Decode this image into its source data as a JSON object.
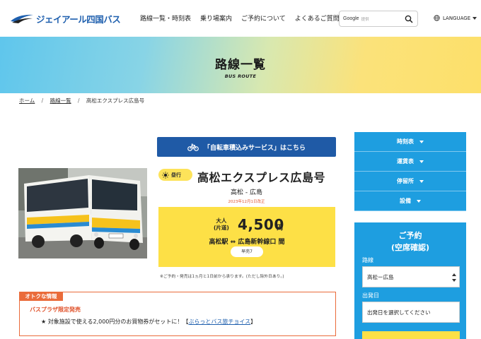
{
  "header": {
    "logo_text": "ジェイアール四国バス",
    "nav": [
      "路線一覧・時刻表",
      "乗り場案内",
      "ご予約について",
      "よくあるご質問"
    ],
    "search_brand": "Google",
    "search_hint": "提供",
    "language_label": "LANGUAGE"
  },
  "hero": {
    "title": "路線一覧",
    "subtitle": "BUS ROUTE"
  },
  "breadcrumb": {
    "home": "ホーム",
    "list": "路線一覧",
    "current": "高松エクスプレス広島号"
  },
  "bike_button_label": "「自転車積込みサービス」はこちら",
  "route": {
    "badge": "昼行",
    "title": "高松エクスプレス広島号",
    "subtitle": "高松 - 広島",
    "revised": "2023年12月1日改正"
  },
  "fare": {
    "type_line1": "大人",
    "type_line2": "(片道)",
    "price": "4,500",
    "unit": "円",
    "between": "高松駅 ⇔ 広島新幹線口 間",
    "button_label": "早売7"
  },
  "note": "※ご予約・発売は1ヵ月と1日前から承ります。(ただし除外日あり。)",
  "deals": {
    "tag": "オトクな情報",
    "title": "バスプラザ限定発売",
    "line_prefix": "★ 対象施設で使える2,000円分のお買物券がセットに！【",
    "line_link": "ぶらっとバス旅チョイス",
    "line_suffix": "】"
  },
  "sidebar": {
    "items": [
      "時刻表",
      "運賃表",
      "停留所",
      "設備"
    ]
  },
  "reservation": {
    "title_line1": "ご予約",
    "title_line2": "(空席確認)",
    "route_label": "路線",
    "route_value": "高松ー広島",
    "date_label": "出発日",
    "date_placeholder": "出発日を選択してください"
  },
  "colors": {
    "brand_blue": "#1e5fae",
    "sidebar_blue": "#1e9ee0",
    "fare_yellow": "#fde046",
    "deal_orange": "#ea6b3a"
  }
}
